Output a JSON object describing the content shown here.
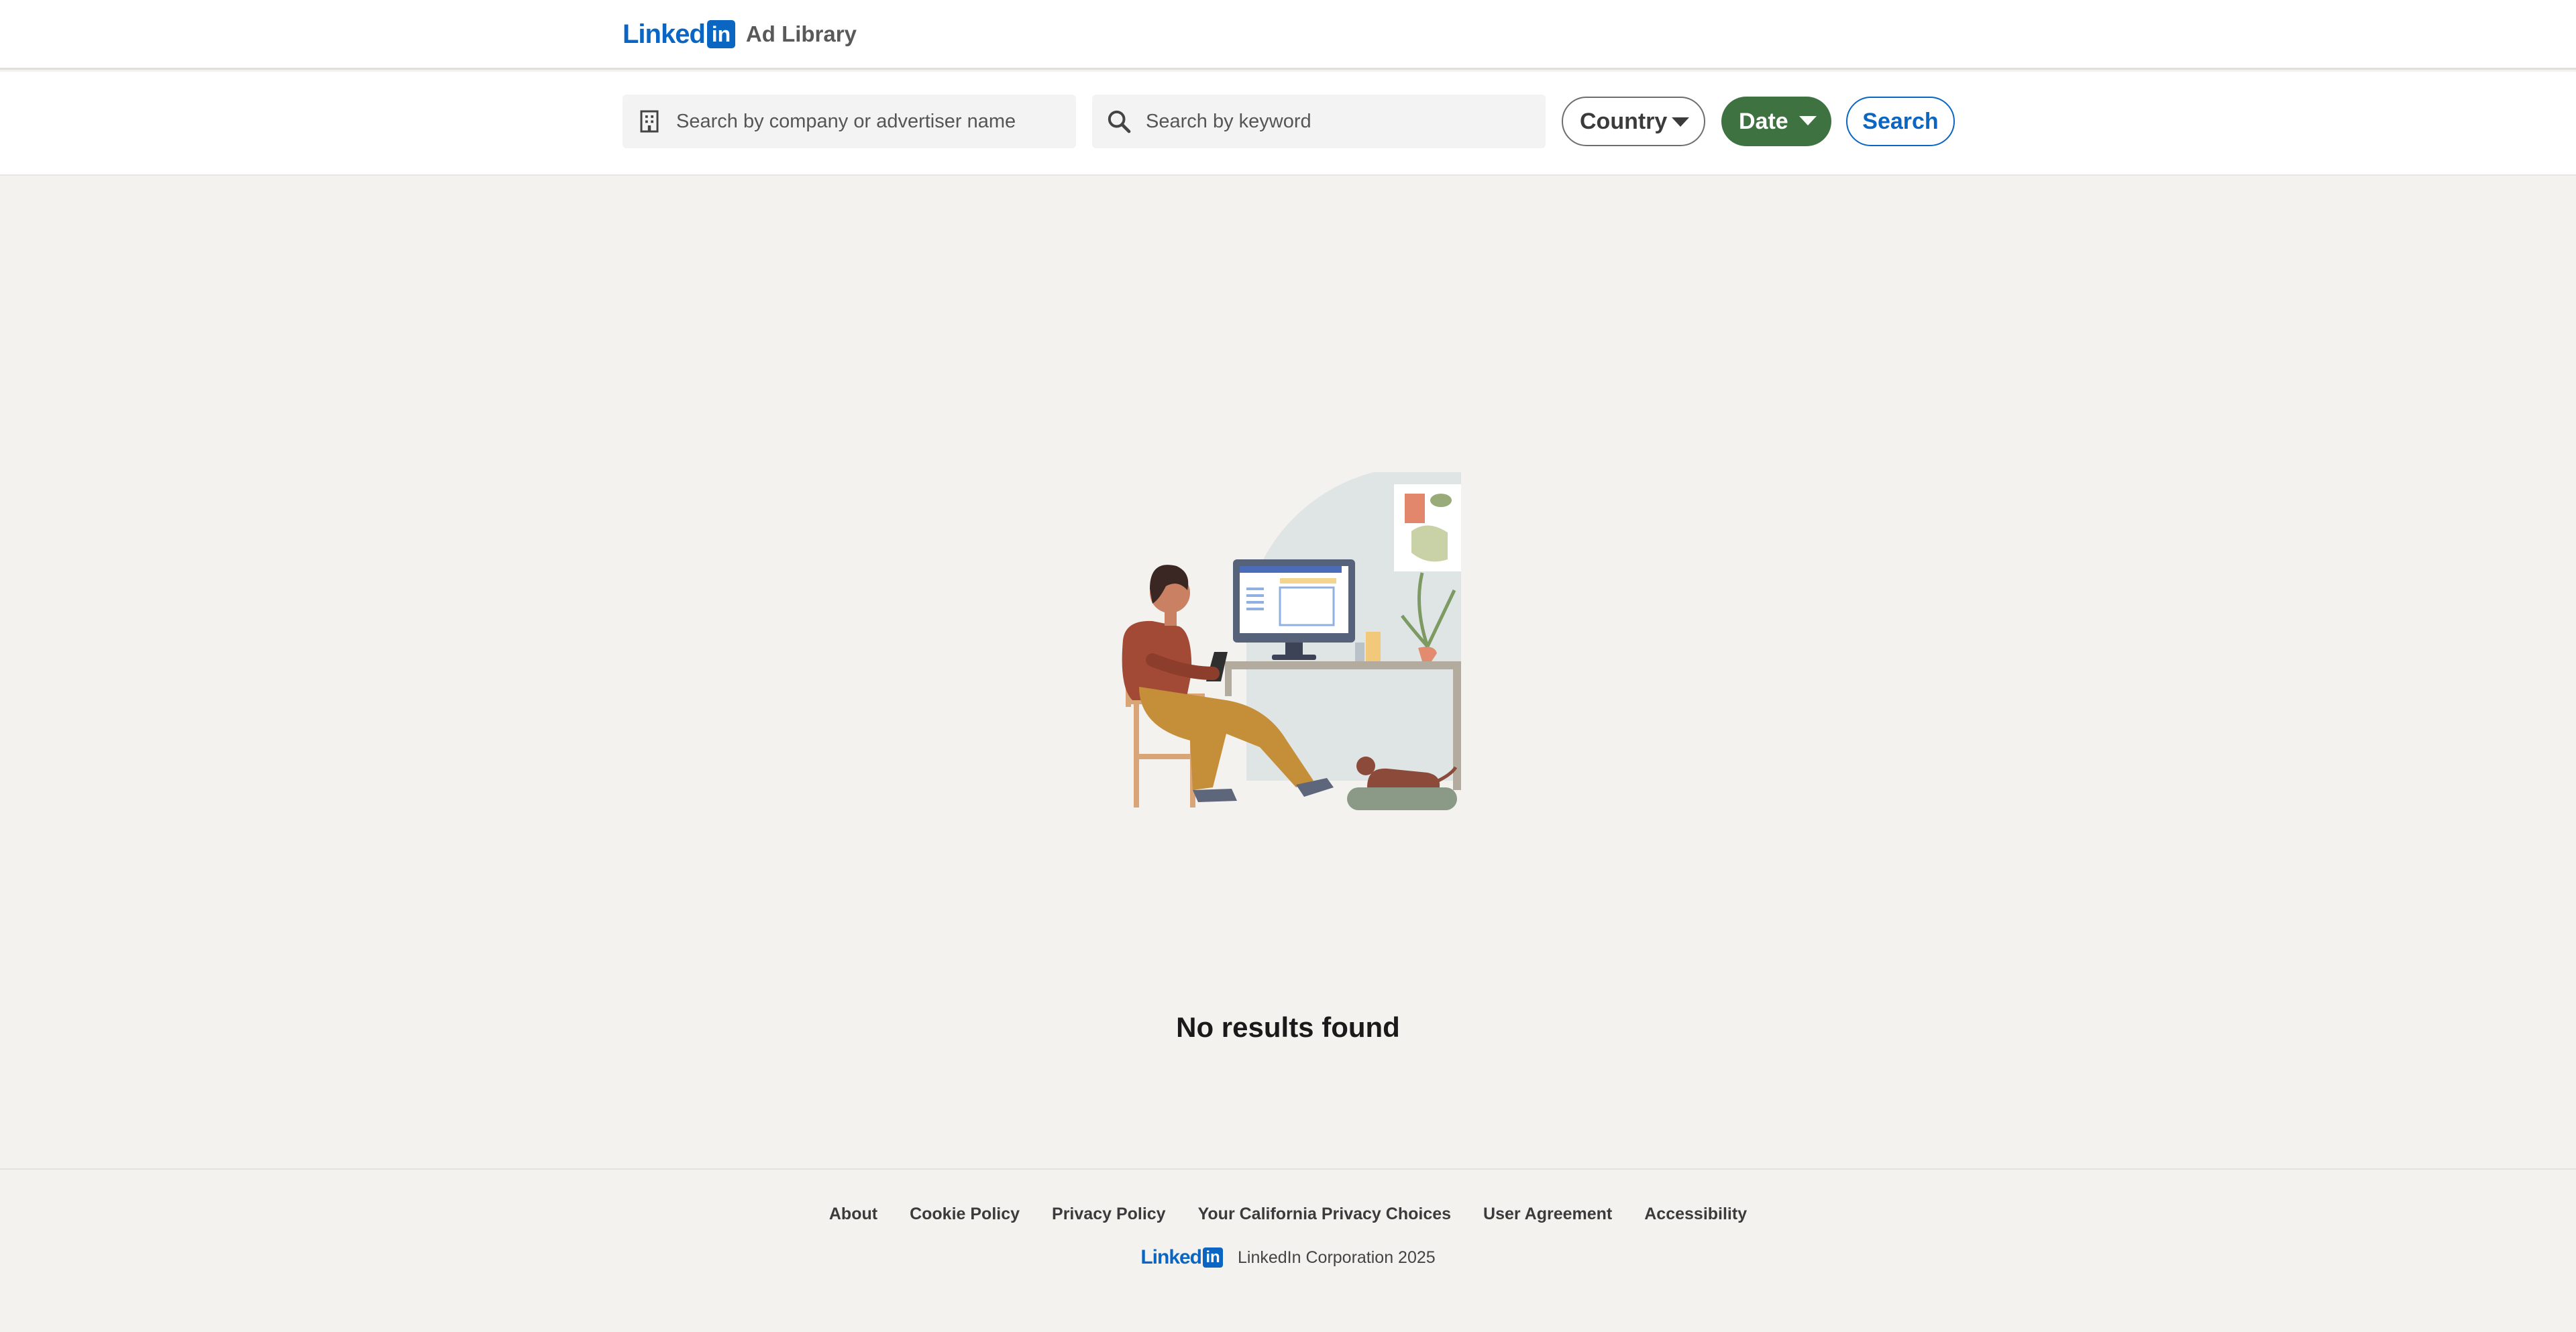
{
  "header": {
    "logo": {
      "word": "Linked",
      "box": "in"
    },
    "title": "Ad Library"
  },
  "search": {
    "company_placeholder": "Search by company or advertiser name",
    "company_icon": "building-icon",
    "keyword_placeholder": "Search by keyword",
    "keyword_icon": "search-icon",
    "country_label": "Country",
    "date_label": "Date",
    "search_label": "Search"
  },
  "main": {
    "empty_message": "No results found",
    "illustration": "person-at-desk-illustration"
  },
  "footer": {
    "links": [
      "About",
      "Cookie Policy",
      "Privacy Policy",
      "Your California Privacy Choices",
      "User Agreement",
      "Accessibility"
    ],
    "logo": {
      "word": "Linked",
      "box": "in"
    },
    "copyright": "LinkedIn Corporation 2025"
  },
  "colors": {
    "brand_blue": "#0a66c2",
    "date_pill_green": "#3e7240",
    "page_background": "#f3f2ef"
  }
}
